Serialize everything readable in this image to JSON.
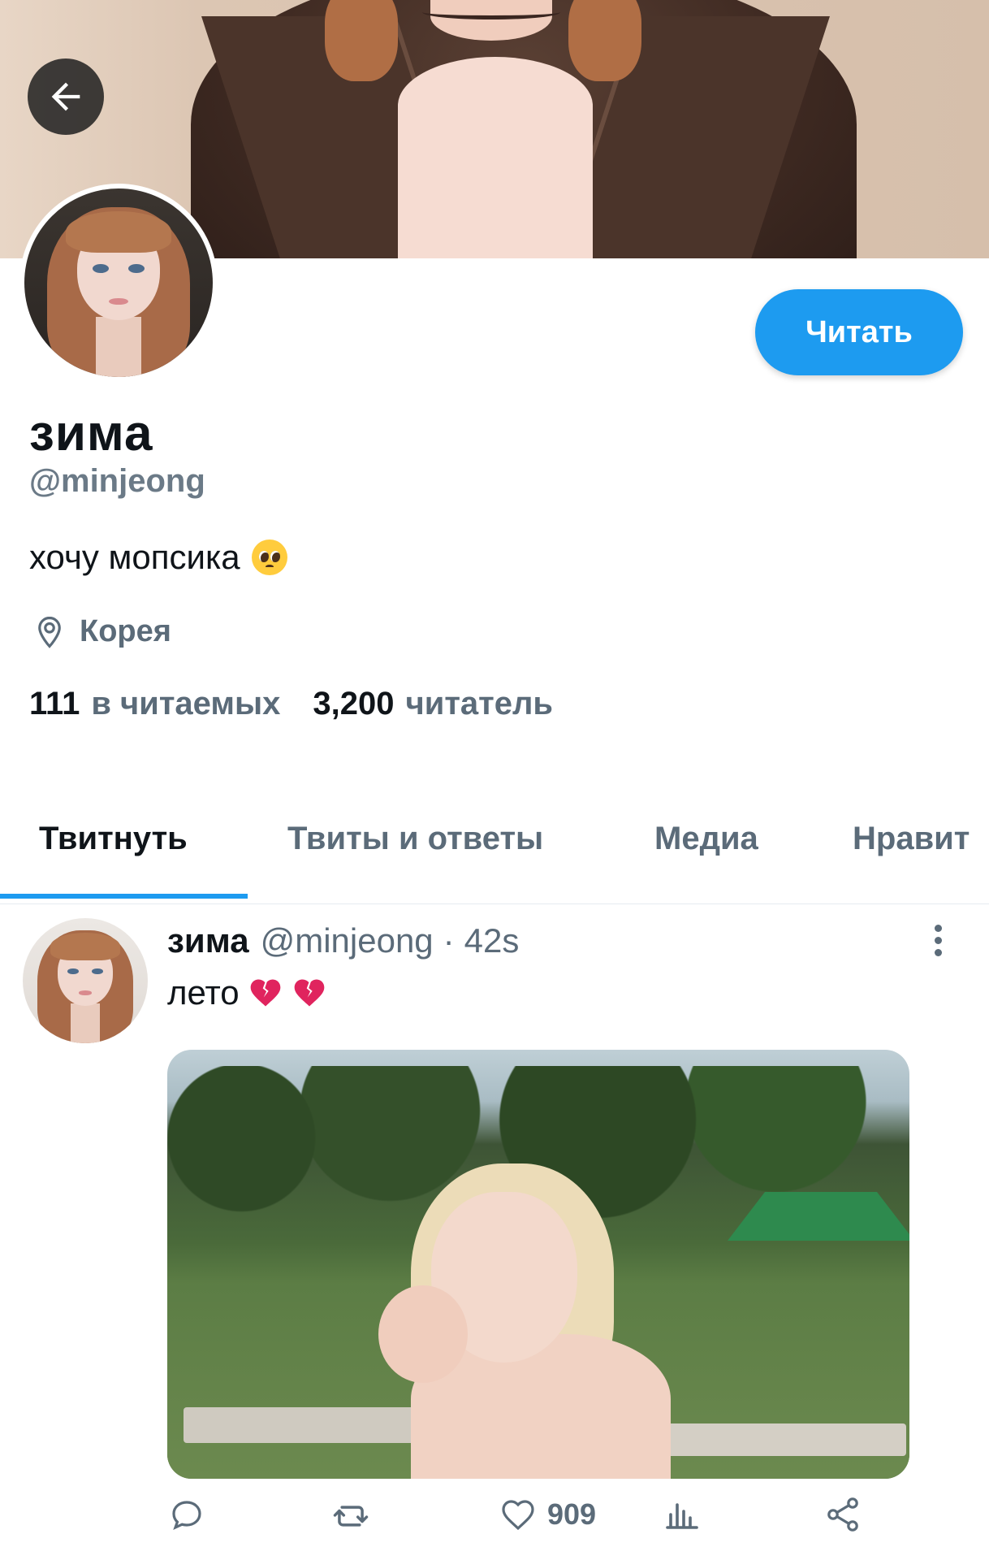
{
  "profile": {
    "display_name": "зима",
    "handle": "@minjeong",
    "bio": "хочу мопсика",
    "bio_emoji": "pleading-face-emoji",
    "location": "Корея",
    "following_count": "111",
    "following_label": "в читаемых",
    "followers_count": "3,200",
    "followers_label": "читатель",
    "follow_button_label": "Читать"
  },
  "tabs": [
    {
      "label": "Твитнуть",
      "active": true
    },
    {
      "label": "Твиты и ответы",
      "active": false
    },
    {
      "label": "Медиа",
      "active": false
    },
    {
      "label": "Нравит",
      "active": false
    }
  ],
  "tweet": {
    "name": "зима",
    "handle": "@minjeong",
    "separator": "·",
    "time": "42s",
    "text": "лето",
    "emojis": [
      "broken-heart-emoji",
      "broken-heart-emoji"
    ],
    "like_count": "909"
  },
  "icons": {
    "back": "arrow-left-icon",
    "location": "location-pin-icon",
    "more": "more-vertical-icon",
    "reply": "reply-icon",
    "retweet": "retweet-icon",
    "like": "heart-icon",
    "views": "views-icon",
    "share": "share-icon"
  },
  "colors": {
    "accent": "#1d9bf0",
    "text_primary": "#0f1419",
    "text_secondary": "#5b6b79"
  }
}
